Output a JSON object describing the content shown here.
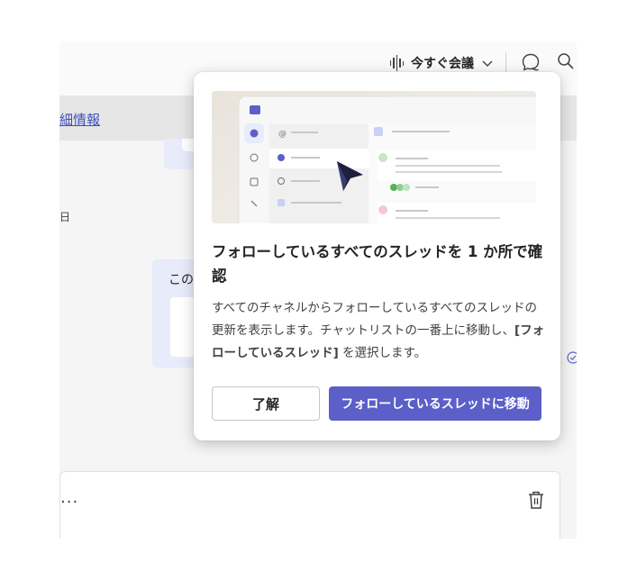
{
  "header": {
    "meet_now_label": "今すぐ会議",
    "detail_link": "細情報"
  },
  "conversation": {
    "date_fragment": "日",
    "message_fragment": "この",
    "compose_more": "..."
  },
  "popup": {
    "title": "フォローしているすべてのスレッドを 1 か所で確認",
    "body_prefix": "すべてのチャネルからフォローしているすべてのスレッドの更新を表示します。チャットリストの一番上に移動し、",
    "body_bold": "[フォローしているスレッド]",
    "body_suffix": " を選択します。",
    "ok_button": "了解",
    "go_button": "フォローしているスレッドに移動"
  },
  "colors": {
    "accent": "#5b5fc7",
    "link": "#3d4fb8",
    "bubble": "#e8ebfa"
  }
}
